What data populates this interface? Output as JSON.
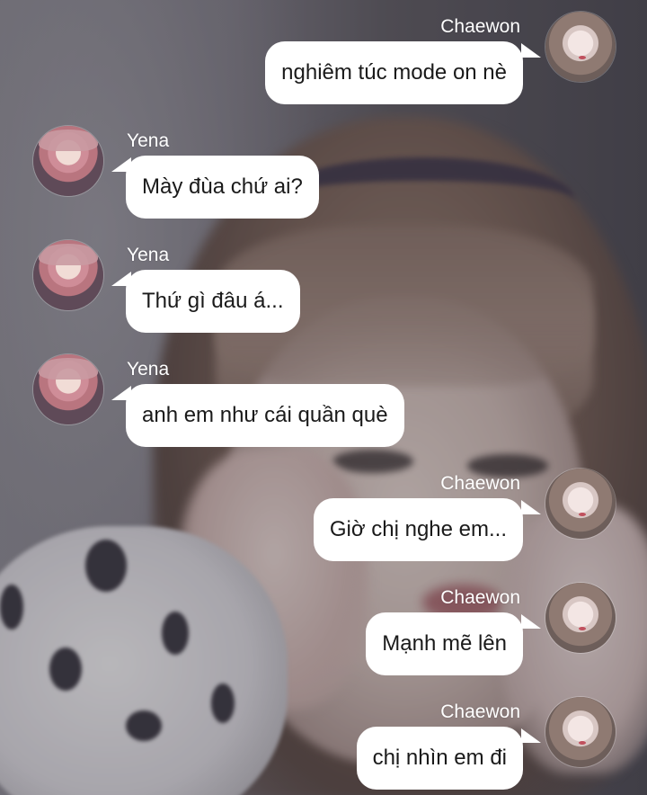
{
  "messages": [
    {
      "sender": "Chaewon",
      "text": "nghiêm túc mode on nè",
      "side": "right",
      "avatar": "chaewon-avatar-icon"
    },
    {
      "sender": "Yena",
      "text": "Mày đùa chứ ai?",
      "side": "left",
      "avatar": "yena-avatar-icon"
    },
    {
      "sender": "Yena",
      "text": "Thứ gì đâu á...",
      "side": "left",
      "avatar": "yena-avatar-icon"
    },
    {
      "sender": "Yena",
      "text": "anh em như cái quần què",
      "side": "left",
      "avatar": "yena-avatar-icon"
    },
    {
      "sender": "Chaewon",
      "text": "Giờ chị nghe em...",
      "side": "right",
      "avatar": "chaewon-avatar-icon"
    },
    {
      "sender": "Chaewon",
      "text": "Mạnh mẽ lên",
      "side": "right",
      "avatar": "chaewon-avatar-icon"
    },
    {
      "sender": "Chaewon",
      "text": "chị nhìn em đi",
      "side": "right",
      "avatar": "chaewon-avatar-icon"
    }
  ],
  "colors": {
    "bubble": "#ffffff",
    "bubble_text": "#1a1a1a",
    "sender_name": "#ffffff"
  }
}
